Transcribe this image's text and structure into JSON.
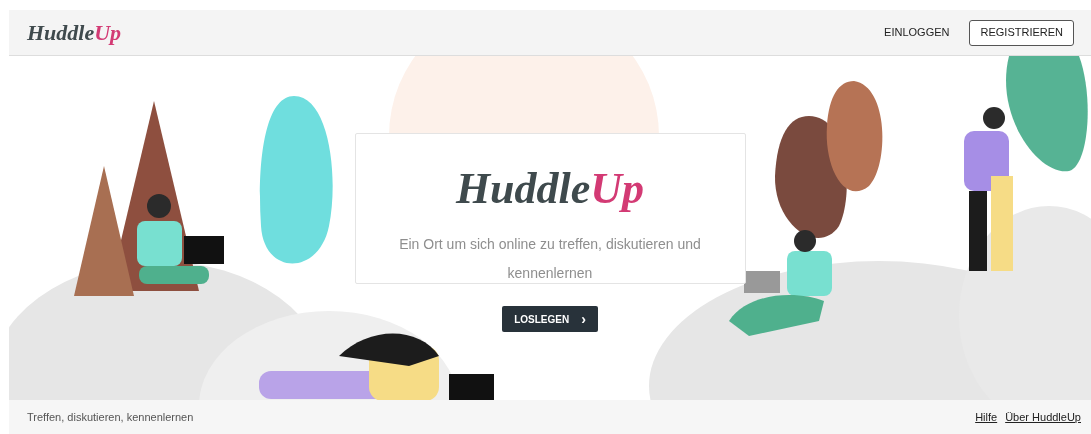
{
  "header": {
    "logo": {
      "dark": "Huddle",
      "accent": "Up"
    },
    "actions": [
      {
        "label": "EINLOGGEN",
        "kind": "link"
      },
      {
        "label": "REGISTRIEREN",
        "kind": "outlined"
      }
    ]
  },
  "hero": {
    "logo": {
      "dark": "Huddle",
      "accent": "Up"
    },
    "tagline": "Ein Ort um sich online zu treffen, diskutieren und kennenlernen",
    "cta": {
      "label": "LOSLEGEN",
      "icon": "›"
    }
  },
  "footer": {
    "slogan": "Treffen, diskutieren, kennenlernen",
    "links": [
      "Hilfe",
      "Über HuddleUp"
    ]
  }
}
